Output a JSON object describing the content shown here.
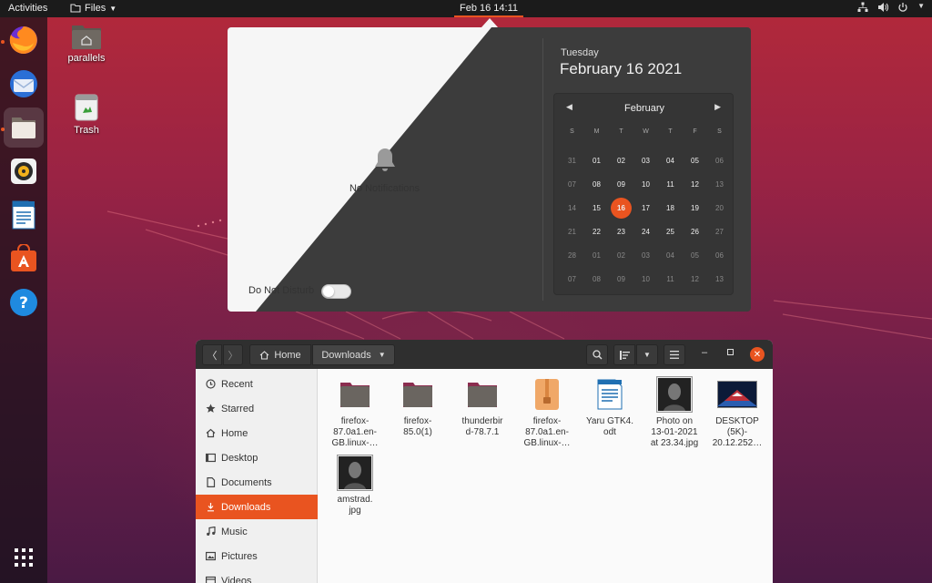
{
  "topbar": {
    "activities": "Activities",
    "app_menu": "Files",
    "clock": "Feb 16  14:11"
  },
  "desktop": {
    "icons": [
      {
        "label": "parallels",
        "icon": "home-folder-icon"
      },
      {
        "label": "Trash",
        "icon": "trash-icon"
      }
    ]
  },
  "dock": {
    "apps": [
      "Firefox",
      "Thunderbird",
      "Files",
      "Rhythmbox",
      "LibreOffice Writer",
      "Ubuntu Software",
      "Help"
    ],
    "show_apps": "Show Applications"
  },
  "calendar_popover": {
    "notifications_empty": "No Notifications",
    "dnd_label": "Do Not Disturb",
    "dnd_enabled": false,
    "weekday": "Tuesday",
    "full_date": "February 16 2021",
    "month": "February",
    "day_headers": [
      "S",
      "M",
      "T",
      "W",
      "T",
      "F",
      "S"
    ],
    "days": [
      [
        "31",
        "01",
        "02",
        "03",
        "04",
        "05",
        "06"
      ],
      [
        "07",
        "08",
        "09",
        "10",
        "11",
        "12",
        "13"
      ],
      [
        "14",
        "15",
        "16",
        "17",
        "18",
        "19",
        "20"
      ],
      [
        "21",
        "22",
        "23",
        "24",
        "25",
        "26",
        "27"
      ],
      [
        "28",
        "01",
        "02",
        "03",
        "04",
        "05",
        "06"
      ],
      [
        "07",
        "08",
        "09",
        "10",
        "11",
        "12",
        "13"
      ]
    ],
    "today": "16",
    "accent": "#e95420"
  },
  "file_manager": {
    "path": [
      "Home",
      "Downloads"
    ],
    "sidebar": [
      {
        "label": "Recent",
        "icon": "clock-icon"
      },
      {
        "label": "Starred",
        "icon": "star-icon"
      },
      {
        "label": "Home",
        "icon": "home-icon"
      },
      {
        "label": "Desktop",
        "icon": "desktop-icon"
      },
      {
        "label": "Documents",
        "icon": "document-icon"
      },
      {
        "label": "Downloads",
        "icon": "download-icon",
        "active": true
      },
      {
        "label": "Music",
        "icon": "music-icon"
      },
      {
        "label": "Pictures",
        "icon": "picture-icon"
      },
      {
        "label": "Videos",
        "icon": "video-icon"
      }
    ],
    "files": [
      {
        "name": "firefox-\n87.0a1.en-\nGB.linux-…",
        "icon": "folder-icon"
      },
      {
        "name": "firefox-\n85.0(1)",
        "icon": "folder-icon"
      },
      {
        "name": "thunderbir\nd-78.7.1",
        "icon": "folder-icon"
      },
      {
        "name": "firefox-\n87.0a1.en-\nGB.linux-…",
        "icon": "archive-icon"
      },
      {
        "name": "Yaru GTK4.\nodt",
        "icon": "odt-document-icon"
      },
      {
        "name": "Photo on\n13-01-2021\nat 23.34.jpg",
        "icon": "photo-thumbnail-icon"
      },
      {
        "name": "DESKTOP\n(5K)-\n20.12.252…",
        "icon": "image-thumbnail-icon"
      },
      {
        "name": "amstrad.\njpg",
        "icon": "photo-thumbnail-icon"
      }
    ]
  }
}
